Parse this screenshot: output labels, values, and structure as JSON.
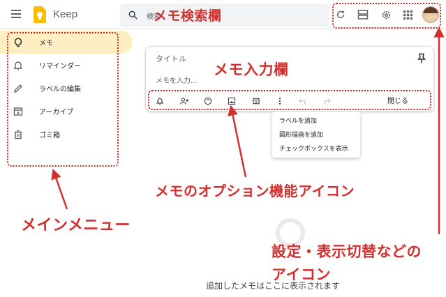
{
  "app": {
    "title": "Keep"
  },
  "search": {
    "placeholder": "検索"
  },
  "header_actions": [
    {
      "name": "refresh-icon"
    },
    {
      "name": "list-view-icon"
    },
    {
      "name": "settings-icon"
    },
    {
      "name": "apps-grid-icon"
    },
    {
      "name": "account-avatar"
    }
  ],
  "sidebar": {
    "items": [
      {
        "label": "メモ",
        "icon": "lightbulb-icon",
        "active": true
      },
      {
        "label": "リマインダー",
        "icon": "bell-icon"
      },
      {
        "label": "ラベルの編集",
        "icon": "pencil-icon"
      },
      {
        "label": "アーカイブ",
        "icon": "archive-icon"
      },
      {
        "label": "ゴミ箱",
        "icon": "trash-icon"
      }
    ]
  },
  "note": {
    "title_placeholder": "タイトル",
    "body_placeholder": "メモを入力...",
    "close_label": "閉じる",
    "toolbar": [
      "reminder-icon",
      "collaborator-icon",
      "palette-icon",
      "image-icon",
      "archive-icon",
      "more-icon",
      "undo-icon",
      "redo-icon"
    ]
  },
  "more_menu": {
    "items": [
      "ラベルを追加",
      "図形描画を追加",
      "チェックボックスを表示"
    ]
  },
  "empty_state": {
    "text": "追加したメモはここに表示されます"
  },
  "annotations": {
    "search": "メモ検索欄",
    "note": "メモ入力欄",
    "options": "メモのオプション機能アイコン",
    "menu": "メインメニュー",
    "settings_line1": "設定・表示切替などの",
    "settings_line2": "アイコン"
  },
  "colors": {
    "accent": "#fbbc04",
    "active_bg": "#feefc3",
    "annotation": "#d32f2f"
  }
}
